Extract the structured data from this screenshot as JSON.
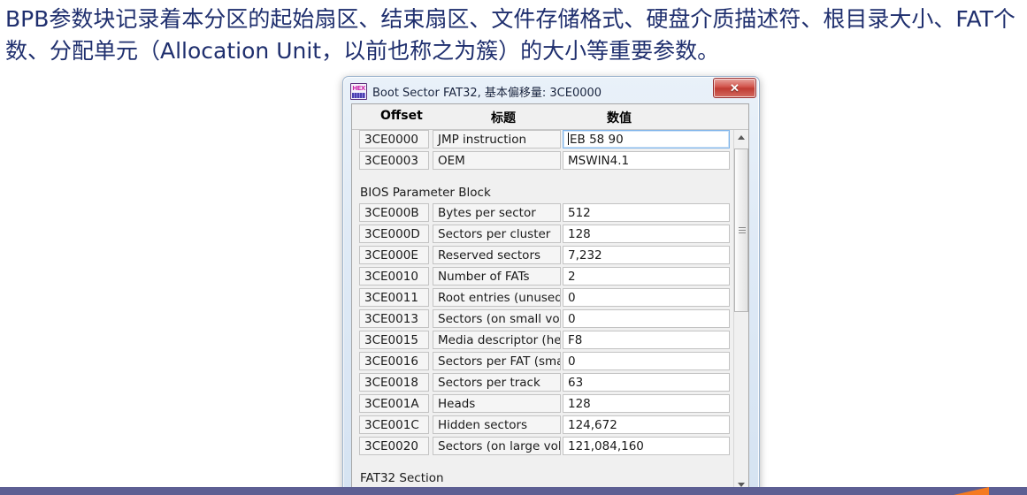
{
  "slide": {
    "body_text": "BPB参数块记录着本分区的起始扇区、结束扇区、文件存储格式、硬盘介质描述符、根目录大小、FAT个数、分配单元（Allocation Unit，以前也称之为簇）的大小等重要参数。",
    "text_color": "#1f2f6e",
    "bottom_bar_color": "#5d5f93",
    "accent_color": "#f57a20"
  },
  "dialog": {
    "title": "Boot Sector FAT32, 基本偏移量: 3CE0000",
    "icon": "hex-editor-icon",
    "close_label": "✕",
    "columns": {
      "offset": "Offset",
      "title": "标题",
      "value": "数值"
    },
    "sections": [
      {
        "label": "",
        "rows": [
          {
            "offset": "3CE0000",
            "title": "JMP instruction",
            "value": "EB 58 90",
            "focused": true
          },
          {
            "offset": "3CE0003",
            "title": "OEM",
            "value": "MSWIN4.1",
            "focused": false
          }
        ]
      },
      {
        "label": "BIOS Parameter Block",
        "rows": [
          {
            "offset": "3CE000B",
            "title": "Bytes per sector",
            "value": "512",
            "focused": false
          },
          {
            "offset": "3CE000D",
            "title": "Sectors per cluster",
            "value": "128",
            "focused": false
          },
          {
            "offset": "3CE000E",
            "title": "Reserved sectors",
            "value": "7,232",
            "focused": false
          },
          {
            "offset": "3CE0010",
            "title": "Number of FATs",
            "value": "2",
            "focused": false
          },
          {
            "offset": "3CE0011",
            "title": "Root entries (unused)",
            "value": "0",
            "focused": false
          },
          {
            "offset": "3CE0013",
            "title": "Sectors (on small volume)",
            "value": "0",
            "focused": false
          },
          {
            "offset": "3CE0015",
            "title": "Media descriptor (hex)",
            "value": "F8",
            "focused": false
          },
          {
            "offset": "3CE0016",
            "title": "Sectors per FAT (small vol.)",
            "value": "0",
            "focused": false
          },
          {
            "offset": "3CE0018",
            "title": "Sectors per track",
            "value": "63",
            "focused": false
          },
          {
            "offset": "3CE001A",
            "title": "Heads",
            "value": "128",
            "focused": false
          },
          {
            "offset": "3CE001C",
            "title": "Hidden sectors",
            "value": "124,672",
            "focused": false
          },
          {
            "offset": "3CE0020",
            "title": "Sectors (on large volume)",
            "value": "121,084,160",
            "focused": false
          }
        ]
      },
      {
        "label": "FAT32 Section",
        "rows": []
      }
    ],
    "scrollbar": {
      "up_arrow": "scroll-up-icon",
      "down_arrow": "scroll-down-icon"
    }
  }
}
